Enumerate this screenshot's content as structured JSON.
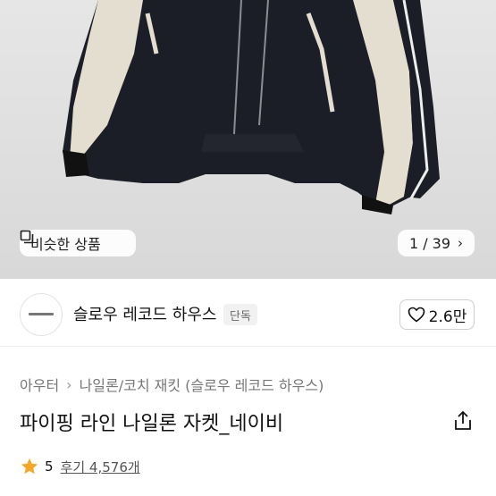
{
  "gallery": {
    "similar_label": "비슷한 상품",
    "page_indicator": "1 / 39"
  },
  "seller": {
    "name": "슬로우 레코드 하우스",
    "badge": "단독",
    "likes": "2.6만"
  },
  "breadcrumb": [
    "아우터",
    "나일론/코치 재킷 (슬로우 레코드 하우스)"
  ],
  "product": {
    "title": "파이핑 라인 나일론 자켓_네이비"
  },
  "rating": {
    "score": "5",
    "reviews": "후기 4,576개"
  },
  "colors": {
    "star": "#f5a623",
    "jacket_navy": "#1b1e26",
    "jacket_panel": "#e4ded0"
  }
}
